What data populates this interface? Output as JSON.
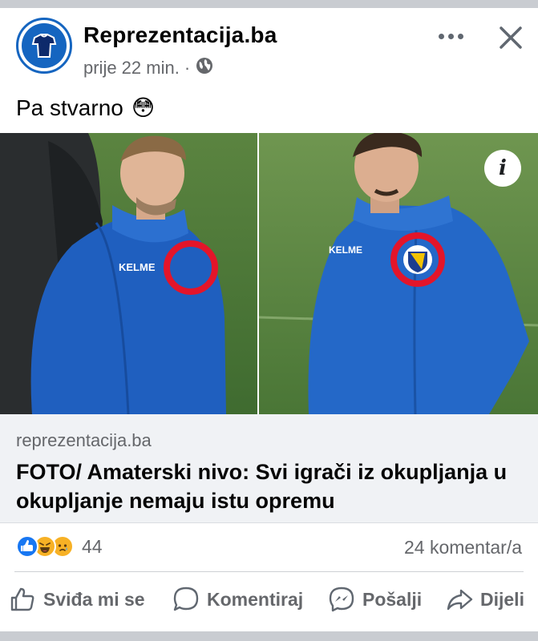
{
  "post": {
    "page_name": "Reprezentacija.ba",
    "time": "prije 22 min.",
    "separator": "·",
    "text": "Pa stvarno",
    "text_emoji": "😳"
  },
  "photo": {
    "left_jersey_brand": "KELME",
    "right_jersey_brand": "KELME"
  },
  "link": {
    "domain": "reprezentacija.ba",
    "title": "FOTO/ Amaterski nivo: Svi igrači iz okupljanja u okupljanje nemaju istu opremu"
  },
  "stats": {
    "reaction_count": "44",
    "comment_count": "24 komentar/a"
  },
  "actions": {
    "like": "Sviđa mi se",
    "comment": "Komentiraj",
    "send": "Pošalji",
    "share": "Dijeli"
  },
  "colors": {
    "brand_blue": "#1565c0",
    "highlight_red": "#e3152a",
    "like_blue": "#1877f2",
    "haha_yellow": "#f7b125"
  }
}
